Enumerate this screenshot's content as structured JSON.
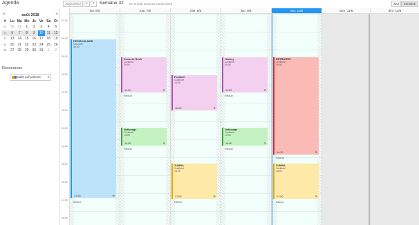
{
  "topbar": {
    "app_title": "Agenda",
    "today_label": "Aujourd'hui",
    "prev_icon": "chevron-left",
    "next_icon": "chevron-right",
    "week_title": "Semaine 32",
    "week_range": "Du 6 août 2018 au 5 août 2018",
    "view_day": "Jour",
    "view_week": "Semaine"
  },
  "mini_calendar": {
    "title": "août 2018",
    "prev": "<",
    "next": ">",
    "headers": [
      "#",
      "Lu",
      "Ma",
      "Me",
      "Je",
      "Ve",
      "Sa",
      "Di"
    ],
    "weeks": [
      [
        "31",
        "30",
        "31",
        "1",
        "2",
        "3",
        "4",
        "5"
      ],
      [
        "32",
        "6",
        "7",
        "8",
        "9",
        "10",
        "11",
        "12"
      ],
      [
        "33",
        "13",
        "14",
        "15",
        "16",
        "17",
        "18",
        "19"
      ],
      [
        "34",
        "20",
        "21",
        "22",
        "23",
        "24",
        "25",
        "26"
      ],
      [
        "35",
        "27",
        "28",
        "29",
        "30",
        "31",
        "1",
        "2"
      ]
    ],
    "first_row": [
      "31",
      "30",
      "31",
      "1",
      "2",
      "3",
      "4",
      "5"
    ]
  },
  "resources": {
    "title": "Ressources",
    "selected": "Salle polyvalente",
    "colors": [
      "#f5a000",
      "#3a6fd8"
    ]
  },
  "hours": [
    "07:00",
    "08:00",
    "09:00",
    "10:00",
    "11:00",
    "12:00",
    "13:00",
    "14:00",
    "15:00",
    "16:00",
    "17:00",
    "18:00"
  ],
  "days": [
    {
      "label": "lun. 6/8"
    },
    {
      "label": "mar. 7/8"
    },
    {
      "label": "mer. 8/8"
    },
    {
      "label": "jeu. 9/8"
    },
    {
      "label": "ven. 10/8"
    },
    {
      "label": "sam. 11/8"
    },
    {
      "label": "dim. 12/8"
    }
  ],
  "events": {
    "mon_1": {
      "title": "PERISCOLAIRE",
      "line1": "Vira-Giel",
      "line2": "08:00",
      "end": "17:00",
      "after": "Début"
    },
    "tue_1": {
      "title": "Ecole de Roeh",
      "line1": "Confirmé",
      "line2": "09:00",
      "end": "11:00",
      "after": "Réduit"
    },
    "tue_2": {
      "title": "Nettoyage",
      "line1": "Confirmé",
      "line2": "13:00",
      "end": "14:00",
      "after": "Réduit"
    },
    "wed_1": {
      "title": "Football",
      "line1": "Confirmé",
      "line2": "10:00",
      "end": "12:00",
      "after": "Réduit"
    },
    "wed_2": {
      "title": "ZUMBA",
      "line1": "Confirmé",
      "line2": "15:00",
      "end": "17:00",
      "after": "Début"
    },
    "thu_1": {
      "title": "Hockey",
      "line1": "Confirmé",
      "line2": "09:00",
      "end": "11:00",
      "after": "Réduit"
    },
    "thu_2": {
      "title": "Nettoyage",
      "line1": "Confirmé",
      "line2": "13:00",
      "end": "14:00",
      "after": "Réduit"
    },
    "fri_1": {
      "title": "RETRAITES",
      "line1": "Confirmé",
      "line2": "09:00",
      "end": "14:30",
      "after": "Réduit"
    },
    "fri_2": {
      "title": "ZUMBA",
      "line1": "Confirmé",
      "line2": "15:00",
      "end": "17:00",
      "after": "Début"
    }
  }
}
